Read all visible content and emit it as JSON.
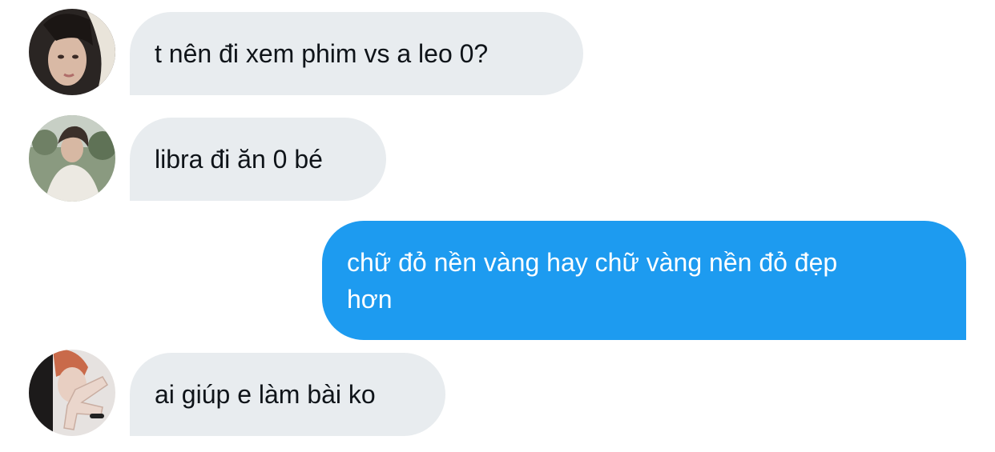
{
  "colors": {
    "incoming_bubble": "#e8ecef",
    "outgoing_bubble": "#1d9bf0",
    "incoming_text": "#0f1419",
    "outgoing_text": "#ffffff"
  },
  "messages": [
    {
      "direction": "incoming",
      "avatar": "avatar-photo-hooded-person",
      "text": "t nên đi xem phim vs a leo 0?"
    },
    {
      "direction": "incoming",
      "avatar": "avatar-photo-person-outdoors",
      "text": "libra đi ăn 0 bé"
    },
    {
      "direction": "outgoing",
      "text_line1": "chữ đỏ nền vàng hay chữ vàng nền đỏ đẹp",
      "text_line2": "hơn"
    },
    {
      "direction": "incoming",
      "avatar": "avatar-photo-person-hand-pose",
      "text": "ai giúp e làm bài ko"
    }
  ]
}
